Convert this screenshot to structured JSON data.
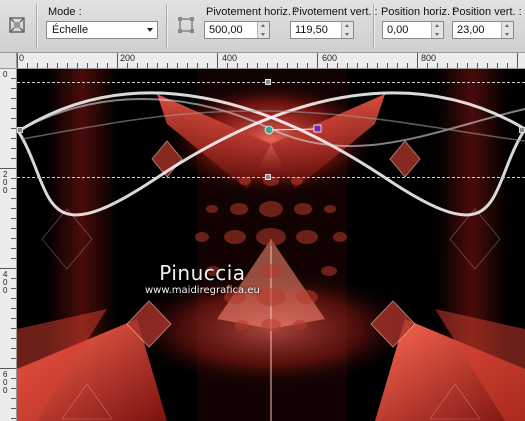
{
  "toolbar": {
    "mode_label": "Mode :",
    "mode_value": "Échelle",
    "pivot_h_label": "Pivotement horiz. :",
    "pivot_h_value": "500,00",
    "pivot_v_label": "Pivotement vert. :",
    "pivot_v_value": "119,50",
    "pos_h_label": "Position horiz. :",
    "pos_h_value": "0,00",
    "pos_v_label": "Position vert. :",
    "pos_v_value": "23,00"
  },
  "ruler_h": {
    "labels": [
      "0",
      "200",
      "400",
      "600",
      "800"
    ]
  },
  "ruler_v": {
    "labels": [
      "0",
      "2\n0\n0",
      "4\n0\n0",
      "6\n0\n0"
    ]
  },
  "canvas": {
    "watermark_name": "Pinuccia",
    "watermark_url": "www.maidiregrafica.eu"
  },
  "colors": {
    "toolbar": "#d4d4d4",
    "accent_red": "#c0342a",
    "deformation_handle": "#6a2bb5",
    "pivot_handle": "#3aa88e"
  },
  "icons": {
    "pick_tool": "pick-tool-icon",
    "deform_tool": "deform-tool-icon"
  }
}
